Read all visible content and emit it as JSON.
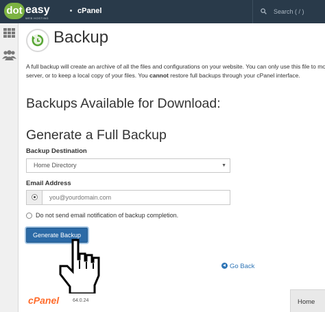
{
  "topbar": {
    "logo_main": "dot",
    "logo_easy": "easy",
    "logo_sub": "WEB HOSTING",
    "product": "cPanel",
    "search_placeholder": "Search ( / )",
    "search_icon": "search-icon",
    "background": "#293a4a"
  },
  "sidebar": {
    "items": [
      {
        "icon": "grid-icon",
        "label": ""
      },
      {
        "icon": "users-icon",
        "label": ""
      }
    ]
  },
  "main": {
    "page_icon": "backup-icon",
    "title": "Backup",
    "description_part1": "A full backup will create an archive of all the files and configurations on your website. You can only use this file to move your account to another",
    "description_part2": "server, or to keep a local copy of your files. You ",
    "description_bold": "cannot",
    "description_part3": " restore full backups through your cPanel interface.",
    "available_heading": "Backups Available for Download:",
    "generate_heading": "Generate a Full Backup",
    "destination_label": "Backup Destination",
    "destination_value": "Home Directory",
    "email_label": "Email Address",
    "email_placeholder": "you@yourdomain.com",
    "no_email_text": "Do not send email notification of backup completion.",
    "generate_button": "Generate Backup",
    "go_back": "Go Back",
    "accent": "#2b6aa6"
  },
  "footer": {
    "logo": "cPanel",
    "version": "64.0.24",
    "home": "Home",
    "logo_color": "#ff6c2c"
  }
}
